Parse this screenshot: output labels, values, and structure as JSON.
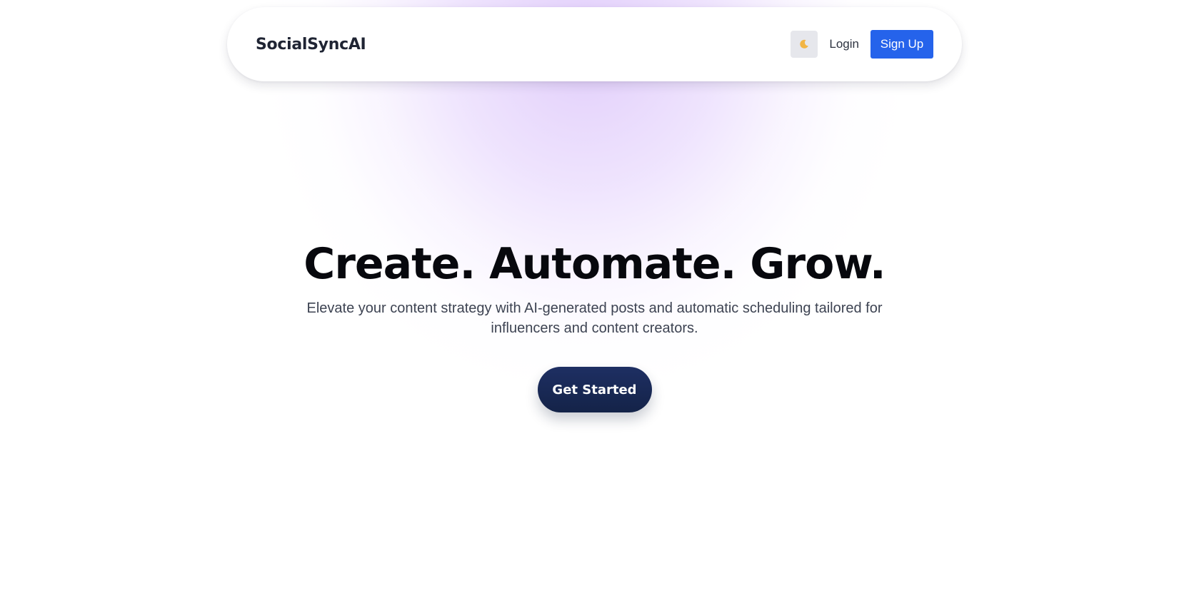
{
  "header": {
    "brand": "SocialSyncAI",
    "theme_toggle_icon": "moon-icon",
    "login_label": "Login",
    "signup_label": "Sign Up"
  },
  "hero": {
    "title": "Create. Automate. Grow.",
    "subtitle": "Elevate your content strategy with AI-generated posts and automatic scheduling tailored for influencers and content creators.",
    "cta_label": "Get Started"
  },
  "colors": {
    "accent": "#2563eb",
    "cta_background": "#1a2a57",
    "glow": "#e3d0fb",
    "heading": "#07080d",
    "body_text": "#3d4352"
  }
}
